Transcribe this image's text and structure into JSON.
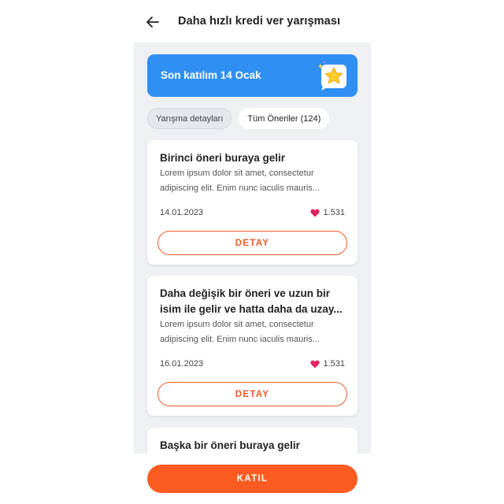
{
  "header": {
    "title": "Daha hızlı kredi ver yarışması",
    "back_icon": "arrow-left-icon"
  },
  "banner": {
    "text": "Son katılım 14 Ocak",
    "icon": "star-icon",
    "color": "#2f8ff3"
  },
  "tabs": [
    {
      "label": "Yarışma detayları",
      "active": false
    },
    {
      "label": "Tüm Öneriler (124)",
      "active": true
    }
  ],
  "cards": [
    {
      "title": "Birinci öneri buraya gelir",
      "body": "Lorem ipsum dolor sit amet, consectetur adipiscing elit. Enim nunc iaculis mauris...",
      "date": "14.01.2023",
      "likes": "1.531",
      "button": "DETAY"
    },
    {
      "title": "Daha değişik bir öneri ve uzun bir isim ile gelir ve hatta daha da uzay...",
      "body": "Lorem ipsum dolor sit amet, consectetur adipiscing elit. Enim nunc iaculis mauris...",
      "date": "16.01.2023",
      "likes": "1.531",
      "button": "DETAY"
    },
    {
      "title": "Başka bir öneri buraya gelir"
    }
  ],
  "footer": {
    "button": "KATIL",
    "color": "#fd5b21"
  },
  "colors": {
    "accent": "#f05a28",
    "heart": "#e0245e",
    "background": "#eef0f3"
  }
}
